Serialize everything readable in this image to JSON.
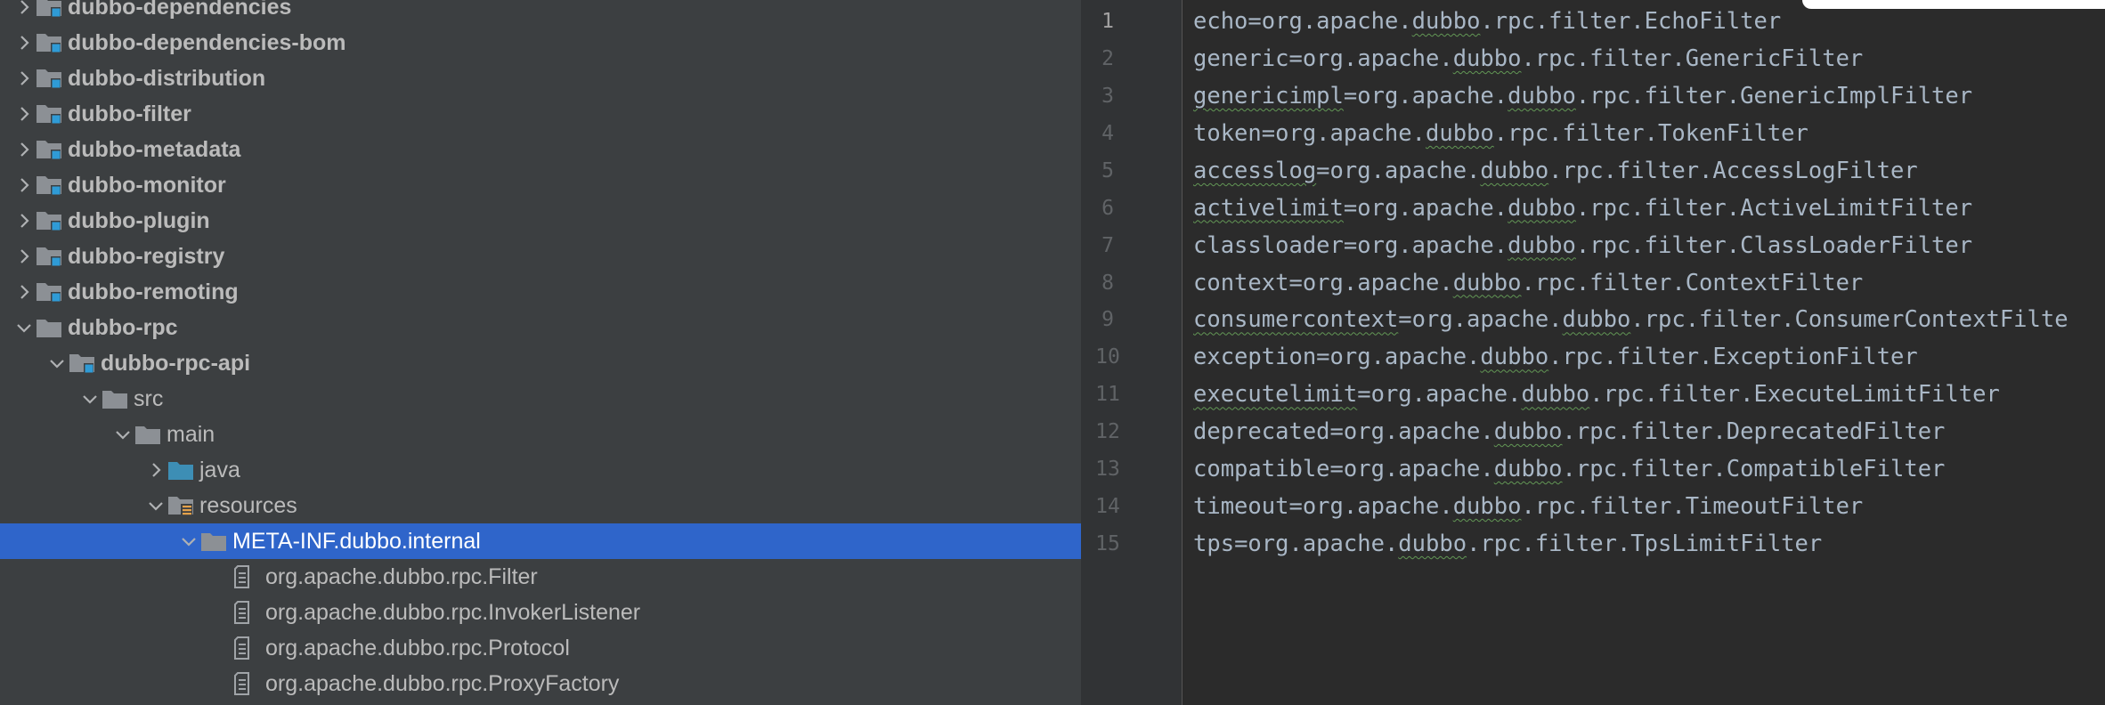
{
  "tree": {
    "rows": [
      {
        "label": "dubbo-dependencies",
        "level": 0,
        "expanded": false,
        "bold": true,
        "icon": "module-folder-icon"
      },
      {
        "label": "dubbo-dependencies-bom",
        "level": 0,
        "expanded": false,
        "bold": true,
        "icon": "module-folder-icon"
      },
      {
        "label": "dubbo-distribution",
        "level": 0,
        "expanded": false,
        "bold": true,
        "icon": "module-folder-icon"
      },
      {
        "label": "dubbo-filter",
        "level": 0,
        "expanded": false,
        "bold": true,
        "icon": "module-folder-icon"
      },
      {
        "label": "dubbo-metadata",
        "level": 0,
        "expanded": false,
        "bold": true,
        "icon": "module-folder-icon"
      },
      {
        "label": "dubbo-monitor",
        "level": 0,
        "expanded": false,
        "bold": true,
        "icon": "module-folder-icon"
      },
      {
        "label": "dubbo-plugin",
        "level": 0,
        "expanded": false,
        "bold": true,
        "icon": "module-folder-icon"
      },
      {
        "label": "dubbo-registry",
        "level": 0,
        "expanded": false,
        "bold": true,
        "icon": "module-folder-icon"
      },
      {
        "label": "dubbo-remoting",
        "level": 0,
        "expanded": false,
        "bold": true,
        "icon": "module-folder-icon"
      },
      {
        "label": "dubbo-rpc",
        "level": 0,
        "expanded": true,
        "bold": true,
        "icon": "folder-icon"
      },
      {
        "label": "dubbo-rpc-api",
        "level": 1,
        "expanded": true,
        "bold": true,
        "icon": "module-folder-icon"
      },
      {
        "label": "src",
        "level": 2,
        "expanded": true,
        "bold": false,
        "icon": "folder-icon"
      },
      {
        "label": "main",
        "level": 3,
        "expanded": true,
        "bold": false,
        "icon": "folder-icon"
      },
      {
        "label": "java",
        "level": 4,
        "expanded": false,
        "bold": false,
        "icon": "source-folder-icon"
      },
      {
        "label": "resources",
        "level": 4,
        "expanded": true,
        "bold": false,
        "icon": "resources-folder-icon"
      },
      {
        "label": "META-INF.dubbo.internal",
        "level": 5,
        "expanded": true,
        "bold": false,
        "icon": "folder-icon",
        "selected": true
      },
      {
        "label": "org.apache.dubbo.rpc.Filter",
        "level": 6,
        "leaf": true,
        "bold": false,
        "icon": "text-file-icon"
      },
      {
        "label": "org.apache.dubbo.rpc.InvokerListener",
        "level": 6,
        "leaf": true,
        "bold": false,
        "icon": "text-file-icon"
      },
      {
        "label": "org.apache.dubbo.rpc.Protocol",
        "level": 6,
        "leaf": true,
        "bold": false,
        "icon": "text-file-icon"
      },
      {
        "label": "org.apache.dubbo.rpc.ProxyFactory",
        "level": 6,
        "leaf": true,
        "bold": false,
        "icon": "text-file-icon"
      }
    ]
  },
  "editor": {
    "lines": [
      {
        "n": "1",
        "key": "echo",
        "val": "EchoFilter",
        "keyTypo": false
      },
      {
        "n": "2",
        "key": "generic",
        "val": "GenericFilter",
        "keyTypo": false
      },
      {
        "n": "3",
        "key": "genericimpl",
        "val": "GenericImplFilter",
        "keyTypo": true
      },
      {
        "n": "4",
        "key": "token",
        "val": "TokenFilter",
        "keyTypo": false
      },
      {
        "n": "5",
        "key": "accesslog",
        "val": "AccessLogFilter",
        "keyTypo": true
      },
      {
        "n": "6",
        "key": "activelimit",
        "val": "ActiveLimitFilter",
        "keyTypo": true
      },
      {
        "n": "7",
        "key": "classloader",
        "val": "ClassLoaderFilter",
        "keyTypo": false
      },
      {
        "n": "8",
        "key": "context",
        "val": "ContextFilter",
        "keyTypo": false
      },
      {
        "n": "9",
        "key": "consumercontext",
        "val": "ConsumerContextFilte",
        "keyTypo": true
      },
      {
        "n": "10",
        "key": "exception",
        "val": "ExceptionFilter",
        "keyTypo": false
      },
      {
        "n": "11",
        "key": "executelimit",
        "val": "ExecuteLimitFilter",
        "keyTypo": true
      },
      {
        "n": "12",
        "key": "deprecated",
        "val": "DeprecatedFilter",
        "keyTypo": false
      },
      {
        "n": "13",
        "key": "compatible",
        "val": "CompatibleFilter",
        "keyTypo": false
      },
      {
        "n": "14",
        "key": "timeout",
        "val": "TimeoutFilter",
        "keyTypo": false
      },
      {
        "n": "15",
        "key": "tps",
        "val": "TpsLimitFilter",
        "keyTypo": false
      }
    ],
    "current_line": "1",
    "mid1": "=org.apache.",
    "pkg": "dubbo",
    "mid2": ".rpc.filter."
  },
  "colors": {
    "tree_bg": "#3c3f41",
    "selection": "#2f65ca",
    "editor_bg": "#2b2b2b",
    "code_text": "#a9b7c6",
    "typo_underline": "#629755"
  }
}
